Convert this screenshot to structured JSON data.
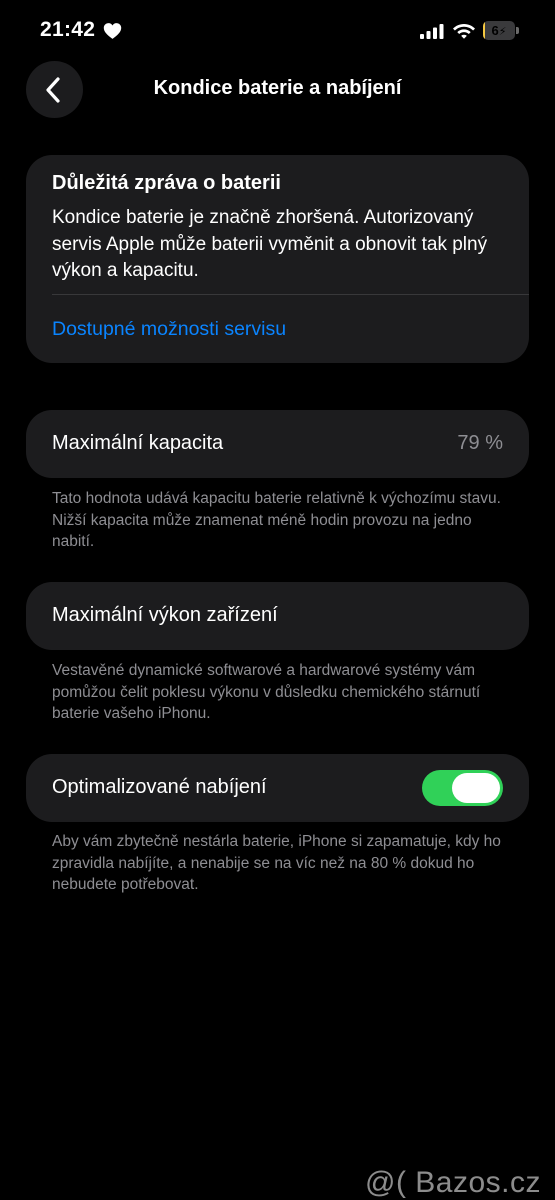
{
  "status_bar": {
    "time": "21:42",
    "heart_icon": "heart-icon",
    "signal_icon": "cellular-signal-icon",
    "wifi_icon": "wifi-icon",
    "battery_text": "6",
    "battery_level": 0.06,
    "battery_color": "#f5c841"
  },
  "nav": {
    "back_icon": "chevron-left-icon",
    "title": "Kondice baterie a nabíjení"
  },
  "important": {
    "title": "Důležitá zpráva o baterii",
    "body": "Kondice baterie je značně zhoršená. Autorizovaný servis Apple může baterii vyměnit a obnovit tak plný výkon a kapacitu.",
    "link": "Dostupné možnosti servisu",
    "link_color": "#0a84ff"
  },
  "max_capacity": {
    "label": "Maximální kapacita",
    "value": "79 %",
    "footnote": "Tato hodnota udává kapacitu baterie relativně k výchozímu stavu. Nižší kapacita může znamenat méně hodin provozu na jedno nabití."
  },
  "peak_performance": {
    "label": "Maximální výkon zařízení",
    "footnote": "Vestavěné dynamické softwarové a hardwarové systémy vám pomůžou čelit poklesu výkonu v důsledku chemického stárnutí baterie vašeho iPhonu."
  },
  "optimized_charging": {
    "label": "Optimalizované nabíjení",
    "enabled": true,
    "toggle_color": "#30d158",
    "footnote": "Aby vám zbytečně nestárla baterie, iPhone si zapamatuje, kdy ho zpravidla nabíjíte, a nenabije se na víc než na 80 % dokud ho nebudete potřebovat."
  },
  "watermark": "@( Bazos.cz"
}
